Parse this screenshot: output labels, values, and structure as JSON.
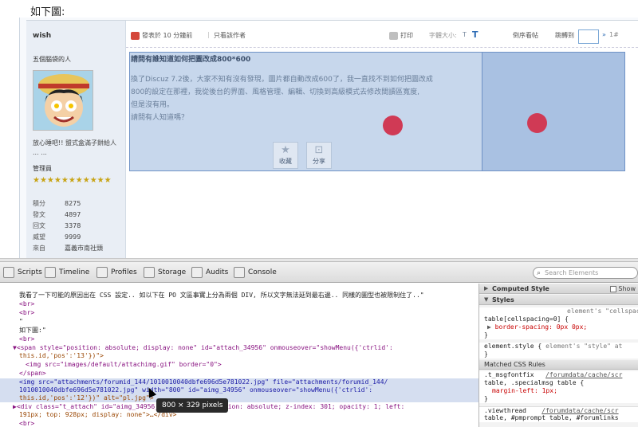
{
  "page": {
    "heading": "如下圖:"
  },
  "author": {
    "name": "wish",
    "title": "五個腦袋的人",
    "signature": "放心睡吧!! 盟式盒滿子餅給人 ... ...",
    "group": "管理員",
    "stars": "★★★★★★★★★★★",
    "stats": [
      {
        "label": "積分",
        "value": "8275"
      },
      {
        "label": "發文",
        "value": "4897"
      },
      {
        "label": "回文",
        "value": "3378"
      },
      {
        "label": "威望",
        "value": "9999"
      },
      {
        "label": "來自",
        "value": "嘉義市南社頭"
      }
    ]
  },
  "postbar": {
    "posted": "發表於 10 分鐘前",
    "only_author": "只看該作者",
    "print": "打印",
    "font_size": "字體大小:",
    "font_small": "T",
    "font_big": "T",
    "order": "倒序看帖",
    "jump": "跳轉到",
    "jump_arrow": "»",
    "floor": "1#"
  },
  "post": {
    "title": "請問有誰知道如何把圖改成800*600",
    "body_lines": [
      "換了Discuz 7.2後，大家不知有沒有發現，圖片都自動改成600了，我一直找不到如何把圖改成",
      "800的設定在那裡，我從後台的界面、風格管理、編輯、切換到高級模式去修改間讀區寬度,",
      "但是沒有用。",
      "請問有人知道嗎？"
    ],
    "fav_label": "收藏",
    "share_label": "分享"
  },
  "devtools": {
    "tabs": [
      "Scripts",
      "Timeline",
      "Profiles",
      "Storage",
      "Audits",
      "Console"
    ],
    "search_placeholder": "Search Elements",
    "lines": [
      {
        "text": "我看了一下可能的原因出在 CSS 設定.. 如以下在 PO 文區事實上分為兩個 DIV, 所以文字無法延到最右邊.. 同樣的圖型也被限制住了..\""
      },
      {
        "text": "<br>"
      },
      {
        "text": "<br>"
      },
      {
        "text": "\""
      },
      {
        "text": "如下圖:\""
      },
      {
        "text": "<br>"
      },
      {
        "text": "▼<span style=\"position: absolute; display: none\" id=\"attach_34956\" onmouseover=\"showMenu({'ctrlid':"
      },
      {
        "text": "this.id,'pos':'13'})\">"
      },
      {
        "text": "<img src=\"images/default/attachimg.gif\" border=\"0\">"
      },
      {
        "text": "</span>"
      },
      {
        "text": "<img src=\"attachments/forumid_144/1010010040dbfe696d5e781022.jpg\" file=\"attachments/forumid_144/"
      },
      {
        "text": "1010010040dbfe696d5e781022.jpg\" width=\"800\" id=\"aimg_34956\" onmouseover=\"showMenu({'ctrlid':"
      },
      {
        "text": "this.id,'pos':'12'})\" alt=\"pl.jpg\">"
      },
      {
        "text": "▶<div class=\"t_attach\" id=\"aimg_34956_menu\" style=\"position: absolute; z-index: 301; opacity: 1; left:"
      },
      {
        "text": "191px; top: 928px; display: none\">…</div>"
      },
      {
        "text": "<br>"
      }
    ],
    "tooltip": "800 × 329 pixels",
    "sidebar": {
      "computed_style": "Computed Style",
      "show_inherited": "Show",
      "styles": "Styles",
      "rule1_comment": "element's \"cellspacing\"",
      "rule1_selector": "table[cellspacing=0] {",
      "rule1_prop": "border-spacing: 0px 0px;",
      "rule_close": "}",
      "rule2_selector": "element.style {",
      "rule2_comment": "element's \"style\" at",
      "matched": "Matched CSS Rules",
      "rule3_selector": ".t_msgfontfix",
      "rule3_src": "/forumdata/cache/scr",
      "rule3_selector2": "table, .specialmsg table {",
      "rule3_prop": "margin-left: 1px;",
      "rule4_selector": ".viewthread",
      "rule4_src": "/forumdata/cache/scr",
      "rule4_selector2": "table, #pmprompt table, #forumlinks"
    }
  }
}
